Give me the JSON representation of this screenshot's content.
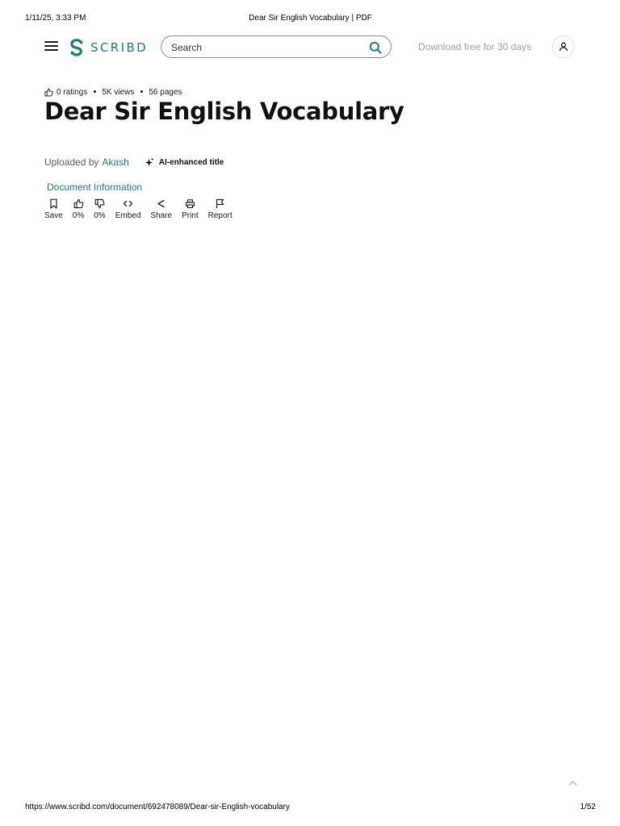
{
  "print_header": {
    "datetime": "1/11/25, 3:33 PM",
    "page_title": "Dear Sir English Vocabulary | PDF"
  },
  "print_footer": {
    "url": "https://www.scribd.com/document/692478089/Dear-sir-English-vocabulary",
    "page_counter": "1/52"
  },
  "nav": {
    "menu_icon": "hamburger-menu-icon",
    "logo_text": "SCRIBD",
    "search": {
      "placeholder": "Search",
      "value": "",
      "icon": "search-icon"
    },
    "download_label": "Download free for 30 days",
    "user_icon": "user-icon"
  },
  "document": {
    "ratings": "0 ratings",
    "views": "5K views",
    "pages": "56 pages",
    "title": "Dear Sir English Vocabulary",
    "uploaded_by_label": "Uploaded by",
    "uploader": "Akash",
    "ai_badge": "AI-enhanced title",
    "info_link": "Document Information"
  },
  "actions": [
    {
      "icon": "bookmark-icon",
      "label": "Save"
    },
    {
      "icon": "thumbs-up-icon",
      "label": "0%"
    },
    {
      "icon": "thumbs-down-icon",
      "label": "0%"
    },
    {
      "icon": "code-icon",
      "label": "Embed"
    },
    {
      "icon": "share-icon",
      "label": "Share"
    },
    {
      "icon": "print-icon",
      "label": "Print"
    },
    {
      "icon": "flag-icon",
      "label": "Report"
    }
  ],
  "colors": {
    "brand": "#1e7b85",
    "muted": "#a0a0a0",
    "text": "#1a1a1a"
  }
}
